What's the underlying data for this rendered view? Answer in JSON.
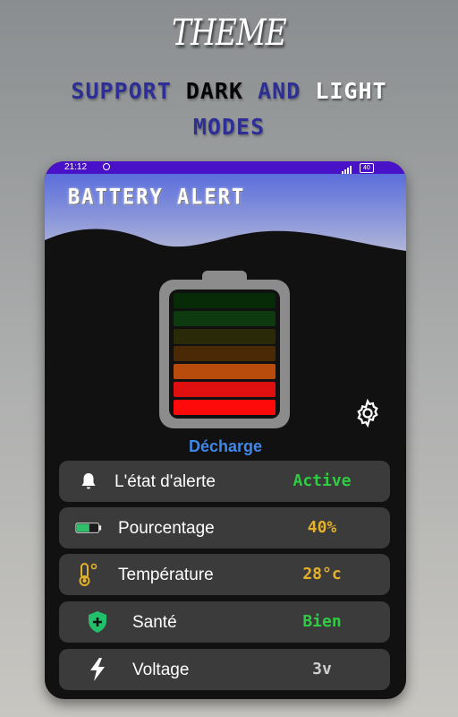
{
  "promo": {
    "title": "THEME",
    "subtitle_support": "SUPPORT",
    "subtitle_dark": "DARK",
    "subtitle_and": "AND",
    "subtitle_light": "LIGHT",
    "subtitle_modes": "MODES"
  },
  "statusbar": {
    "time": "21:12",
    "battery_badge": "40"
  },
  "app": {
    "title": "BATTERY ALERT",
    "status_label": "Décharge",
    "battery_level_percent": 40,
    "battery_cells": [
      "#062b06",
      "#0e3a10",
      "#2a2a08",
      "#4a2a06",
      "#b84c0c",
      "#e01010",
      "#ff0a0a"
    ]
  },
  "rows": [
    {
      "icon": "bell-icon",
      "label": "L'état d'alerte",
      "value": "Active",
      "value_color": "#2ecc40"
    },
    {
      "icon": "battery-icon",
      "label": "Pourcentage",
      "value": "40%",
      "value_color": "#e3b12a"
    },
    {
      "icon": "thermometer-icon",
      "label": "Température",
      "value": "28°c",
      "value_color": "#e3b12a"
    },
    {
      "icon": "shield-plus-icon",
      "label": "Santé",
      "value": "Bien",
      "value_color": "#2ecc40"
    },
    {
      "icon": "lightning-icon",
      "label": "Voltage",
      "value": "3v",
      "value_color": "#cfcfcf"
    }
  ],
  "colors": {
    "accent_blue": "#3f88ea",
    "statusbar": "#4a12c8",
    "row_bg": "#3b3b3b"
  }
}
